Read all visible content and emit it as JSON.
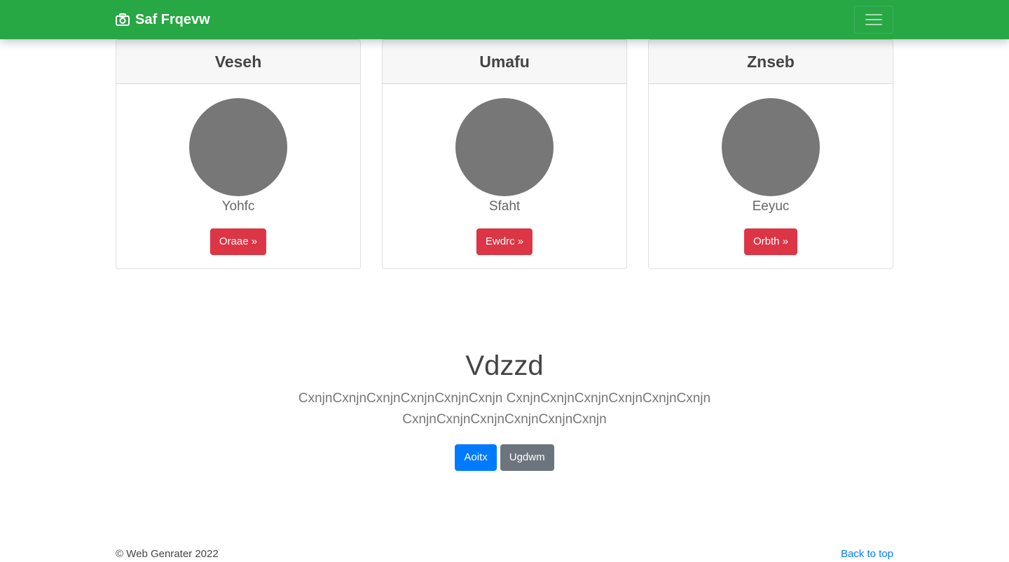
{
  "navbar": {
    "brand": "Saf Frqevw",
    "brand_icon": "camera-icon",
    "toggler_icon": "hamburger-menu-icon",
    "background_color": "#28a745"
  },
  "cards": [
    {
      "header": "Veseh",
      "text": "Yohfc",
      "button": "Oraae »"
    },
    {
      "header": "Umafu",
      "text": "Sfaht",
      "button": "Ewdrc »"
    },
    {
      "header": "Znseb",
      "text": "Eeyuc",
      "button": "Orbth »"
    }
  ],
  "jumbotron": {
    "title": "Vdzzd",
    "lead": "CxnjnCxnjnCxnjnCxnjnCxnjnCxnjn CxnjnCxnjnCxnjnCxnjnCxnjnCxnjn CxnjnCxnjnCxnjnCxnjnCxnjnCxnjn",
    "primary_button": "Aoitx",
    "secondary_button": "Ugdwm"
  },
  "footer": {
    "copyright": "© Web Genrater 2022",
    "back_to_top": "Back to top"
  },
  "colors": {
    "danger": "#dc3545",
    "primary": "#007bff",
    "secondary": "#6c757d",
    "avatar": "#777777"
  }
}
